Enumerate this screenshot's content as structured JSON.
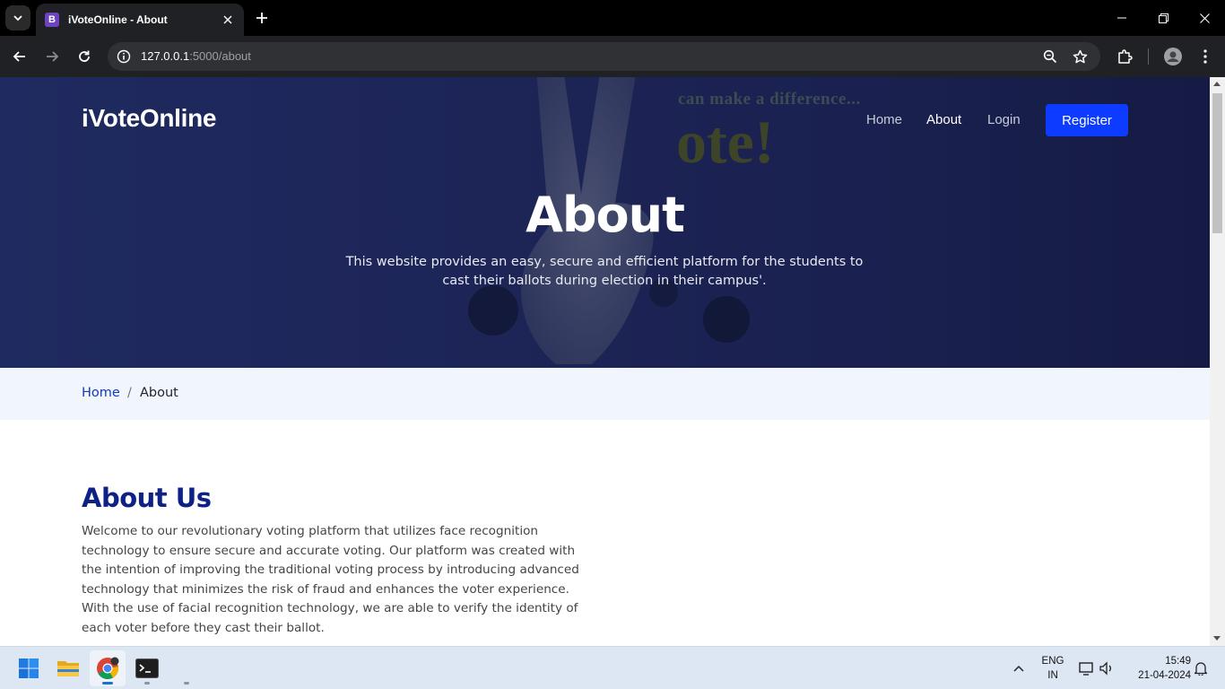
{
  "browser": {
    "tab_title": "iVoteOnline - About",
    "tab_favicon_letter": "B",
    "url_host": "127.0.0.1",
    "url_path": ":5000/about"
  },
  "site": {
    "brand": "iVoteOnline",
    "nav": {
      "home": "Home",
      "about": "About",
      "login": "Login",
      "register": "Register"
    },
    "hero": {
      "image_text_line1": "can make a difference...",
      "image_text_line2": "ote!",
      "title": "About",
      "description": "This website provides an easy, secure and efficient platform for the students to cast their ballots during election in their campus'."
    },
    "breadcrumb": {
      "home": "Home",
      "separator": "/",
      "current": "About"
    },
    "about": {
      "heading": "About Us",
      "paragraph": "Welcome to our revolutionary voting platform that utilizes face recognition technology to ensure secure and accurate voting. Our platform was created with the intention of improving the traditional voting process by introducing advanced technology that minimizes the risk of fraud and enhances the voter experience. With the use of facial recognition technology, we are able to verify the identity of each voter before they cast their ballot."
    }
  },
  "taskbar": {
    "language_line1": "ENG",
    "language_line2": "IN",
    "time": "15:49",
    "date": "21-04-2024"
  },
  "colors": {
    "accent": "#0d3bff",
    "hero_bg": "#1d2557",
    "heading": "#0e2187",
    "breadcrumb_bg": "#f1f5fe"
  }
}
